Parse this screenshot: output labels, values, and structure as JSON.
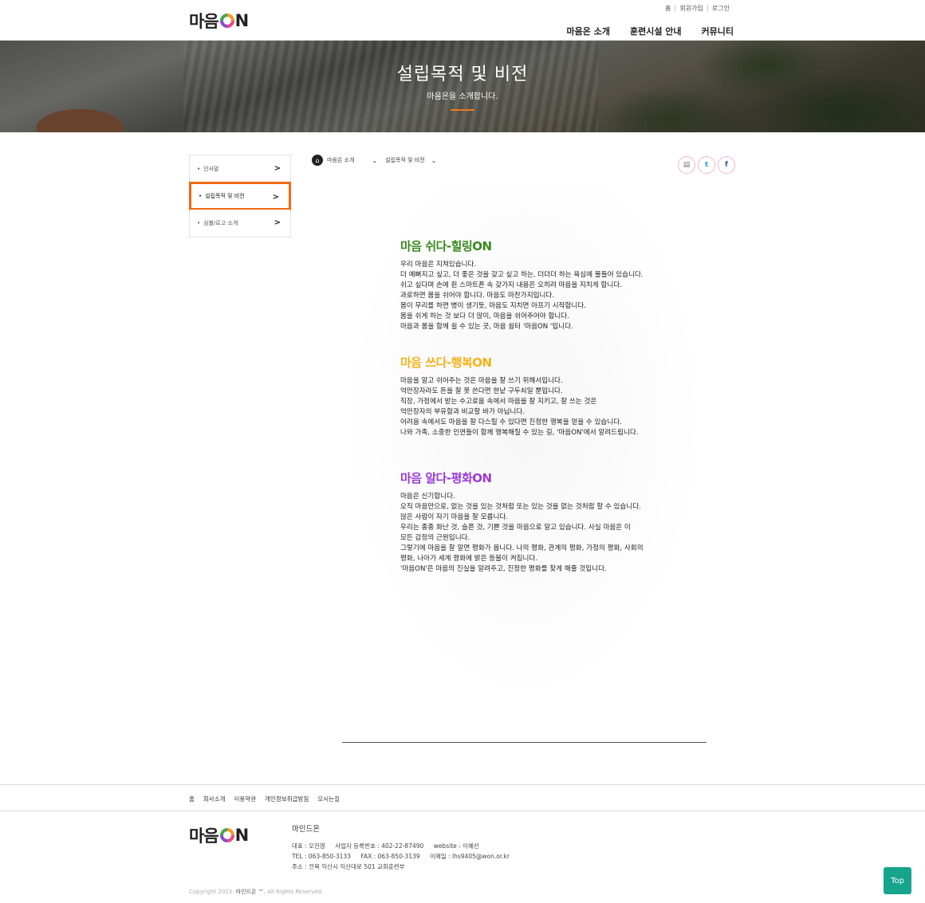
{
  "header": {
    "logo_text": "마음",
    "logo_suffix": "N",
    "util_links": [
      "홈",
      "회원가입",
      "로그인"
    ],
    "gnb": [
      "마음온 소개",
      "훈련시설 안내",
      "커뮤니티"
    ]
  },
  "hero": {
    "title": "설립목적 및 비전",
    "subtitle": "마음온을 소개합니다.",
    "accent_color": "#f07a1a"
  },
  "lnb": {
    "items": [
      {
        "label": "인사말",
        "active": false
      },
      {
        "label": "설립목적 및 비전",
        "active": true
      },
      {
        "label": "심볼/로고 소개",
        "active": false
      }
    ],
    "active_color": "#f06a12"
  },
  "breadcrumb": {
    "home_icon": "home-icon",
    "level1": "마음온 소개",
    "level2": "설립목적 및 비전"
  },
  "share": {
    "icons": [
      "print-icon",
      "twitter-icon",
      "facebook-icon"
    ]
  },
  "sections": [
    {
      "title": "마음 쉬다-힐링ON",
      "color": "#3a8a1e",
      "lines": [
        "우리 마음은 지쳐있습니다.",
        "더 예뻐지고 싶고, 더 좋은 것을 갖고 싶고 하는, 더더더 하는 욕심에 몰들어 있습니다.",
        "쉬고 싶다며 손에 쥔 스마트폰 속 갖가지 내용은 오히려 마음을 지치게 합니다.",
        "과로하면 몸을 쉬어야 합니다. 마음도 마찬가지입니다.",
        "몸이 무리를 하면 병이 생기듯, 마음도 지치면 아프기 시작합니다.",
        "몸을 쉬게 하는 것 보다 더 많이, 마음을 쉬어주어야 합니다.",
        "마음과 몸을 함께 쉴 수 있는 곳, 마음 쉼터 '마음ON '입니다."
      ]
    },
    {
      "title": "마음 쓰다-행복ON",
      "color": "#f5b21a",
      "lines": [
        "마음을 알고 쉬어주는 것은 마음을 잘 쓰기 위해서입니다.",
        "억만장자라도 돈을 잘 못 쓴다면 한낱 구두쇠일 뿐입니다.",
        "직장, 가정에서 받는 수고로움 속에서 마음을 잘 지키고, 잘 쓰는 것은",
        "억만장자의 부유함과 비교할 바가 아닙니다.",
        "어려움 속에서도 마음을 잘 다스릴 수 있다면 진정한 행복을 얻을 수 있습니다.",
        "나와 가족, 소중한 인연들이 함께 행복해질 수 있는 길, '마음ON'에서 알려드립니다."
      ]
    },
    {
      "title": "마음 알다-평화ON",
      "color": "#9b3ad8",
      "lines": [
        "마음은 신기합니다.",
        "오직 마음만으로, 없는 것을 있는 것처럼 또는 있는 것을 없는 것처럼 할 수 있습니다.",
        "많은 사람이 자기 마음을 잘 모릅니다.",
        "우리는 종종 화난 것, 슬픈 것, 기쁜 것을 마음으로 알고 있습니다. 사실 마음은 이",
        "모든 감정의 근원입니다.",
        "그렇기에 마음을 잘 알면 평화가 옵니다. 나의 평화, 관계의 평화, 가정의 평화, 사회의",
        "평화, 나아가 세계 평화에 밝은 등불이 켜집니다.",
        "'마음ON'은 마음의 진실을 알려주고, 진정한 평화를 찾게 해줄 것입니다."
      ]
    }
  ],
  "footer": {
    "links": [
      "홈",
      "회사소개",
      "이용약관",
      "개인정보취급방침",
      "오시는길"
    ],
    "company": "마인드온",
    "info_row1": [
      "대표 : 오진영",
      "사업자 등록번호 : 402-22-87490",
      "website : 이혜선"
    ],
    "info_row2": [
      "TEL : 063-850-3133",
      "FAX : 063-850-3139",
      "이메일 : lhs9405@won.or.kr"
    ],
    "info_row3": "주소 : 전북 익산시 익산대로 501 교화훈련부",
    "copyright_prefix": "Copyright 2023.",
    "copyright_brand": "마인드온 ™.",
    "copyright_suffix": "All Rights Reserved.",
    "top_button": "Top",
    "top_color": "#16a48c"
  }
}
